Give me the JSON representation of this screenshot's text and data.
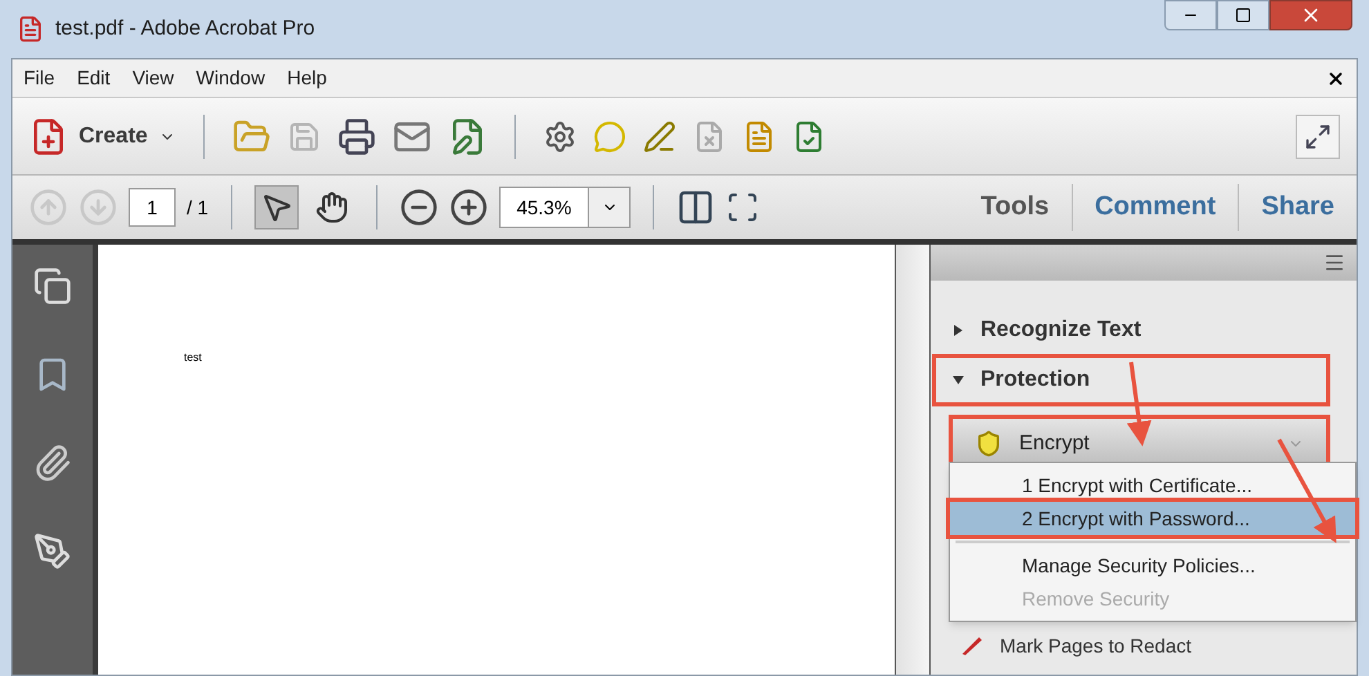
{
  "window": {
    "title": "test.pdf - Adobe Acrobat Pro"
  },
  "menu_bar": [
    "File",
    "Edit",
    "View",
    "Window",
    "Help"
  ],
  "toolbar": {
    "create_label": "Create"
  },
  "nav": {
    "page": "1",
    "page_total": "/ 1",
    "zoom": "45.3%",
    "tools": [
      {
        "kind": "select",
        "selected": true
      },
      {
        "kind": "hand",
        "selected": false
      }
    ]
  },
  "panel_tabs": [
    "Tools",
    "Comment",
    "Share"
  ],
  "document": {
    "text": "test"
  },
  "panel": {
    "sections": [
      {
        "label": "Recognize Text",
        "expanded": false,
        "highlighted": false
      },
      {
        "label": "Protection",
        "expanded": true,
        "highlighted": true
      }
    ],
    "encrypt_button": {
      "label": "Encrypt",
      "highlighted": true
    },
    "menu": [
      {
        "label": "1 Encrypt with Certificate...",
        "selected": false,
        "disabled": false,
        "highlighted": false,
        "divider_above": false
      },
      {
        "label": "2 Encrypt with Password...",
        "selected": true,
        "disabled": false,
        "highlighted": true,
        "divider_above": false
      },
      {
        "label": "Manage Security Policies...",
        "selected": false,
        "disabled": false,
        "highlighted": false,
        "divider_above": true
      },
      {
        "label": "Remove Security",
        "selected": false,
        "disabled": true,
        "highlighted": false,
        "divider_above": false
      }
    ],
    "next_item": "Mark Pages to Redact"
  }
}
